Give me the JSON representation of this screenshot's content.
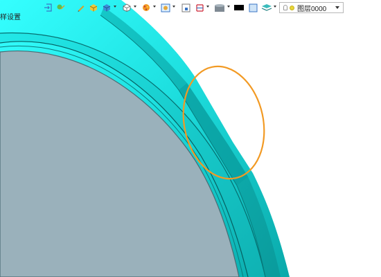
{
  "toolbar": {
    "icons": [
      "exit-icon",
      "toggle-icon",
      "pencil-icon",
      "solid-shade-icon",
      "box-3d-icon",
      "view-cube-icon",
      "render-material-icon",
      "light-icon",
      "snap-icon",
      "section-icon",
      "visual-style-icon",
      "color-swatch-icon",
      "frame-icon",
      "layer-manager-icon"
    ],
    "layer_dropdown": {
      "value": "图层0000"
    }
  },
  "status": {
    "text": "样设置"
  },
  "colors": {
    "part_face": "#1fd0d0",
    "part_edge_dark": "#07989a",
    "interior": "#9ab1bb",
    "highlight_ellipse": "#f29a24",
    "background": "#ffffff"
  }
}
